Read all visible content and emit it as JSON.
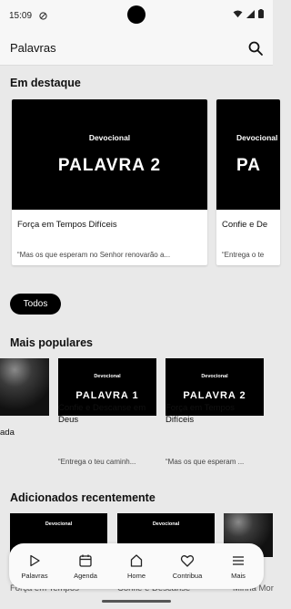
{
  "status": {
    "time": "15:09"
  },
  "app_bar": {
    "title": "Palavras"
  },
  "featured": {
    "title": "Em destaque",
    "items": [
      {
        "thumb_small": "Devocional",
        "thumb_big": "PALAVRA 2",
        "title": "Força em Tempos Difíceis",
        "excerpt": "“Mas os que esperam no Senhor renovarão a..."
      },
      {
        "thumb_small": "Devocional",
        "thumb_big": "PA",
        "title": "Confie e De",
        "excerpt": "“Entrega o te"
      }
    ]
  },
  "filter": {
    "chip_label": "Todos"
  },
  "popular": {
    "title": "Mais populares",
    "items": [
      {
        "title": "ada",
        "excerpt": ""
      },
      {
        "thumb_small": "Devocional",
        "thumb_big": "PALAVRA 1",
        "title": "Confie e Descanse em Deus",
        "excerpt": "“Entrega o teu caminh..."
      },
      {
        "thumb_small": "Devocional",
        "thumb_big": "PALAVRA 2",
        "title": "Força em Tempos Difíceis",
        "excerpt": "“Mas os que esperam ..."
      }
    ]
  },
  "recent": {
    "title": "Adicionados recentemente",
    "items": [
      {
        "thumb_small": "Devocional",
        "title": "Força em Tempos"
      },
      {
        "thumb_small": "Devocional",
        "title": "Confie e Descanse"
      },
      {
        "title": "Minha Mor"
      }
    ]
  },
  "nav": {
    "items": [
      {
        "label": "Palavras",
        "icon": "play-icon"
      },
      {
        "label": "Agenda",
        "icon": "calendar-icon"
      },
      {
        "label": "Home",
        "icon": "home-icon"
      },
      {
        "label": "Contribua",
        "icon": "heart-icon"
      },
      {
        "label": "Mais",
        "icon": "menu-icon"
      }
    ]
  }
}
